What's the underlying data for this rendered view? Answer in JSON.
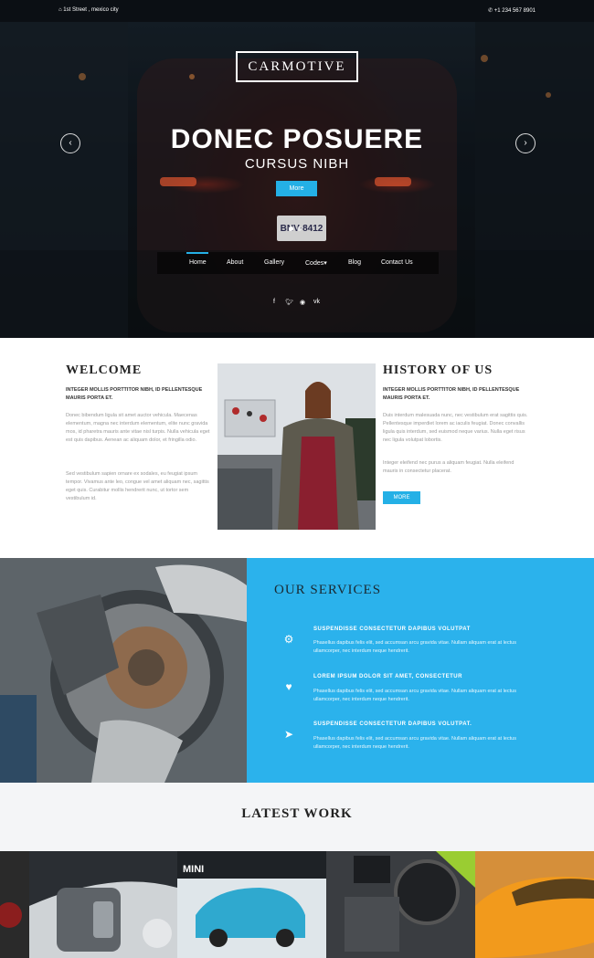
{
  "topbar": {
    "address": "1st Street , mexico city",
    "phone": "+1 234 567 8901"
  },
  "brand": {
    "logo": "CARMOTIVE"
  },
  "hero": {
    "title": "DONEC POSUERE",
    "subtitle": "CURSUS NIBH",
    "button": "More",
    "plate": "BNV·8412",
    "prev": "‹",
    "next": "›"
  },
  "nav": {
    "items": [
      "Home",
      "About",
      "Gallery",
      "Codes▾",
      "Blog",
      "Contact Us"
    ]
  },
  "social": [
    "f",
    "t",
    "rss",
    "vk"
  ],
  "welcome": {
    "title": "WELCOME",
    "lead": "INTEGER MOLLIS PORTTITOR NIBH, ID PELLENTESQUE MAURIS PORTA ET.",
    "p1": "Donec bibendum ligula sit amet auctor vehicula. Maecenas elementum, magna nec interdum elementum, elite nunc gravida mos, id pharetra mauris ante vitae nisl turpis. Nulla vehicula eget est quis dapibus. Aenean ac aliquam dolor, et fringilla odio.",
    "p2": "Sed vestibulum sapien ornare ex sodales, eu feugiat ipsum tempor. Vivamus ante leo, congue vel amet aliquam nec, sagittis eget quis. Curabitur mollis hendrerit nunc, ut tortor sem vestibulum id."
  },
  "history": {
    "title": "HISTORY OF US",
    "lead": "INTEGER MOLLIS PORTTITOR NIBH, ID PELLENTESQUE MAURIS PORTA ET.",
    "p1": "Duis interdum malesuada nunc, nec vestibulum erat sagittis quis. Pellentesque imperdiet lorem ac iaculis feugiat. Donec convallis ligula quis interdum, sed euismod neque varius. Nulla eget risus nec ligula volutpat lobortis.",
    "p2": "Integer eleifend nec purus a aliquam feugiat. Nulla eleifend mauris in consectetur placerat.",
    "button": "MORE"
  },
  "services": {
    "title": "OUR SERVICES",
    "items": [
      {
        "icon": "gear-icon",
        "heading": "SUSPENDISSE CONSECTETUR DAPIBUS VOLUTPAT",
        "text": "Phasellus dapibus felis elit, sed accumsan arcu gravida vitae. Nullam aliquam erat at lectus ullamcorper, nec interdum neque hendrerit."
      },
      {
        "icon": "heart-icon",
        "heading": "LOREM IPSUM DOLOR SIT AMET, CONSECTETUR",
        "text": "Phasellus dapibus felis elit, sed accumsan arcu gravida vitae. Nullam aliquam erat at lectus ullamcorper, nec interdum neque hendrerit."
      },
      {
        "icon": "paper-plane-icon",
        "heading": "SUSPENDISSE CONSECTETUR DAPIBUS VOLUTPAT.",
        "text": "Phasellus dapibus felis elit, sed accumsan arcu gravida vitae. Nullam aliquam erat at lectus ullamcorper, nec interdum neque hendrerit."
      }
    ]
  },
  "latest": {
    "title": "LATEST WORK",
    "mini_logo": "MINI"
  },
  "colors": {
    "accent": "#24b0e6",
    "services_bg": "#2bb2ec",
    "topbar": "#0b0f14"
  }
}
